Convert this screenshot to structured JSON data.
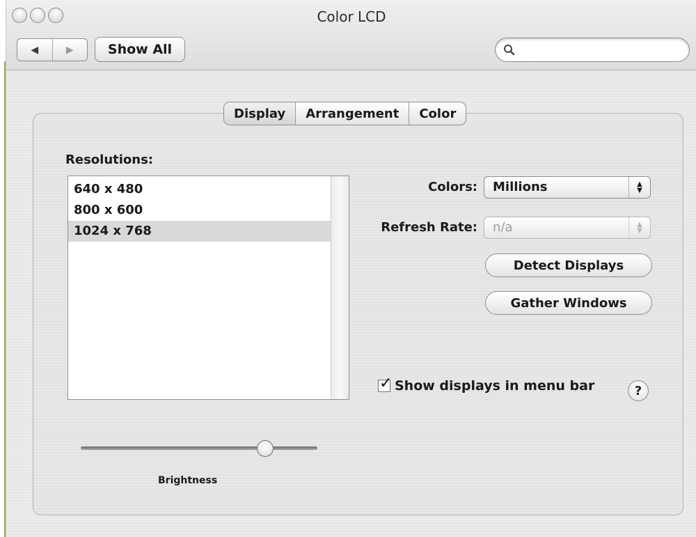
{
  "window": {
    "title": "Color LCD"
  },
  "toolbar": {
    "back_glyph": "◀",
    "forward_glyph": "▶",
    "show_all_label": "Show All",
    "search_value": ""
  },
  "tabs": [
    {
      "label": "Display",
      "selected": true
    },
    {
      "label": "Arrangement",
      "selected": false
    },
    {
      "label": "Color",
      "selected": false
    }
  ],
  "resolutions": {
    "label": "Resolutions:",
    "items": [
      "640 x 480",
      "800 x 600",
      "1024 x 768"
    ],
    "selected_index": 2
  },
  "colors": {
    "label": "Colors:",
    "value": "Millions"
  },
  "refresh_rate": {
    "label": "Refresh Rate:",
    "value": "n/a",
    "disabled": true
  },
  "buttons": {
    "detect_displays": "Detect Displays",
    "gather_windows": "Gather Windows"
  },
  "menu_bar_option": {
    "label": "Show displays in menu bar",
    "checked": true,
    "check_glyph": "✓"
  },
  "help": {
    "glyph": "?"
  },
  "brightness": {
    "label": "Brightness",
    "value_fraction": 0.78
  }
}
